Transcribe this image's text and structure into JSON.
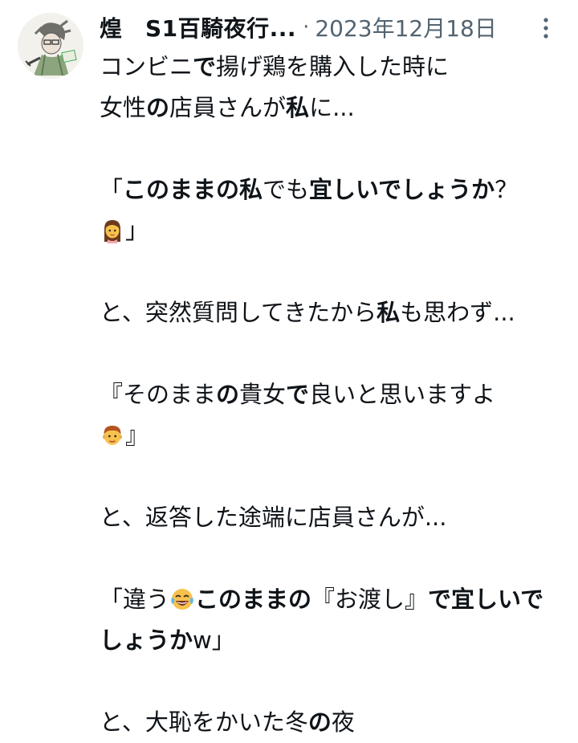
{
  "tweet": {
    "author_name": "煌　S1百騎夜行...",
    "separator": "·",
    "date": "2023年12月18日",
    "avatar_icon": "avatar-illustration",
    "more_icon": "more-vertical-icon",
    "body": {
      "p1": {
        "a": "コンビニ",
        "b": "で",
        "c": "揚げ鶏を購入した時に",
        "d": "女性",
        "e": "の",
        "f": "店員さんが",
        "g": "私",
        "h": "に..."
      },
      "p2": {
        "a": "「",
        "b": "このままの私",
        "c": "でも",
        "d": "宜しいでしょうか",
        "e": "？",
        "emoji": "woman-emoji",
        "f": "」"
      },
      "p3": {
        "a": "と、突然質問してきたから",
        "b": "私",
        "c": "も思わず..."
      },
      "p4": {
        "a": "『そのまま",
        "b": "の",
        "c": "貴女",
        "d": "で",
        "e": "良いと思いますよ",
        "emoji": "man-emoji",
        "f": "』"
      },
      "p5": {
        "a": "と、返答した途端に店員さんが..."
      },
      "p6": {
        "a": "「違う",
        "emoji": "laughing-tears-emoji",
        "b": "このままの",
        "c": "『お渡し』",
        "d": "で宜しいでしょうか",
        "e": "w」"
      },
      "p7": {
        "a": "と、大恥をかいた冬",
        "b": "の",
        "c": "夜"
      }
    }
  },
  "colors": {
    "text": "#0f1419",
    "secondary": "#536471",
    "background": "#ffffff"
  }
}
